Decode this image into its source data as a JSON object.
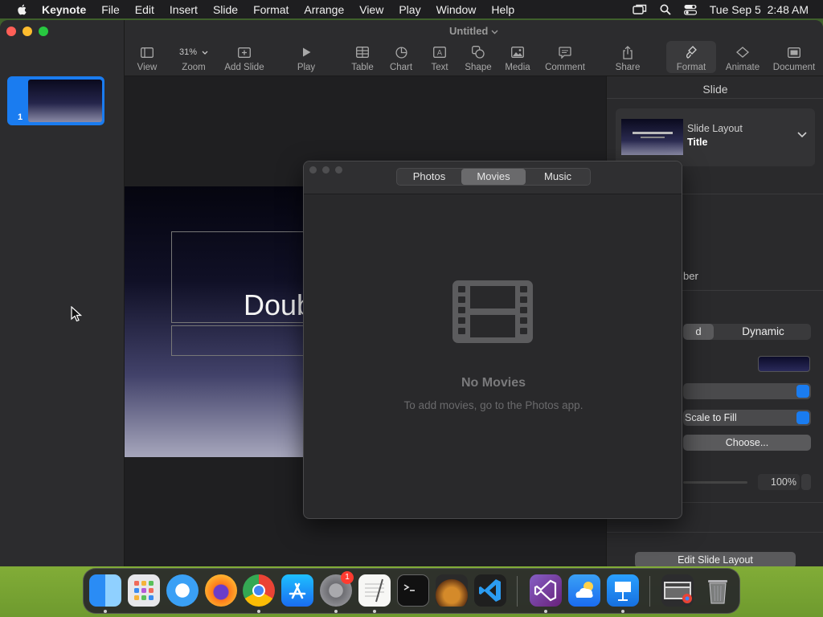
{
  "menubar": {
    "app_name": "Keynote",
    "items": [
      "File",
      "Edit",
      "Insert",
      "Slide",
      "Format",
      "Arrange",
      "View",
      "Play",
      "Window",
      "Help"
    ],
    "datetime": "Tue Sep 5  2:48 AM",
    "icons": [
      "apple-icon",
      "screen-mirroring-icon",
      "spotlight-search-icon",
      "control-center-icon"
    ]
  },
  "window": {
    "document_title": "Untitled",
    "toolbar": {
      "view": "View",
      "zoom_value": "31%",
      "zoom": "Zoom",
      "add_slide": "Add Slide",
      "play": "Play",
      "table": "Table",
      "chart": "Chart",
      "text": "Text",
      "shape": "Shape",
      "media": "Media",
      "comment": "Comment",
      "share": "Share",
      "format": "Format",
      "animate": "Animate",
      "document": "Document"
    }
  },
  "navigator": {
    "slides": [
      {
        "number": "1"
      }
    ]
  },
  "canvas": {
    "slide_title_partial": "Doub"
  },
  "inspector": {
    "title": "Slide",
    "slide_layout_label": "Slide Layout",
    "slide_layout_value": "Title",
    "thumb_text": "Lorem Ipsum Dolor",
    "partial_number_label": "ber",
    "appearance_seg_left": "d",
    "appearance_seg_right": "Dynamic",
    "fill_mode": "Scale to Fill",
    "choose_button": "Choose...",
    "opacity": "100%",
    "edit_layout_button": "Edit Slide Layout"
  },
  "media_browser": {
    "tabs": [
      "Photos",
      "Movies",
      "Music"
    ],
    "active_tab": "Movies",
    "empty_title": "No Movies",
    "empty_subtitle": "To add movies, go to the Photos app."
  },
  "dock": {
    "apps": [
      "Finder",
      "Launchpad",
      "Safari",
      "Firefox",
      "Chrome",
      "App Store",
      "System Settings",
      "TextEdit",
      "Terminal",
      "GarageBand",
      "Visual Studio Code",
      "Visual Studio",
      "Weather",
      "Keynote",
      "Downloads",
      "Trash"
    ],
    "settings_badge": "1"
  },
  "colors": {
    "accent": "#1a7cf0",
    "window_bg": "#262628",
    "popover_bg": "#29292b"
  }
}
